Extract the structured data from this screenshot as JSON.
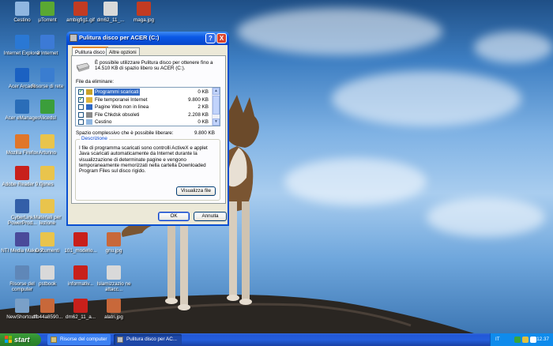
{
  "desktop": {
    "icons": [
      {
        "label": "Cestino",
        "icon": "recycle-bin-icon",
        "color": "#8fb6e0"
      },
      {
        "label": "µTorrent",
        "icon": "utorrent-icon",
        "color": "#5aa832"
      },
      {
        "label": "ambigfig1.gif",
        "icon": "image-file-icon",
        "color": "#c23b22"
      },
      {
        "label": "dm62_11_...",
        "icon": "document-icon",
        "color": "#d9d9d9"
      },
      {
        "label": "maga.jpg",
        "icon": "image-file-icon",
        "color": "#c23b22"
      },
      {
        "label": "Internet Explorer",
        "icon": "internet-explorer-icon",
        "color": "#2a78d4"
      },
      {
        "label": "3 Internet",
        "icon": "network-icon",
        "color": "#3c7ad6"
      },
      {
        "label": "Acer Arcade",
        "icon": "acer-arcade-icon",
        "color": "#1b61c2"
      },
      {
        "label": "Risorse di rete",
        "icon": "network-places-icon",
        "color": "#3a7dd0"
      },
      {
        "label": "Acer eManager",
        "icon": "acer-emanager-icon",
        "color": "#2a6db8"
      },
      {
        "label": "Alicedsl",
        "icon": "alice-icon",
        "color": "#3b9e3b"
      },
      {
        "label": "Mozilla Firefox",
        "icon": "firefox-icon",
        "color": "#e0762a"
      },
      {
        "label": "Arturino",
        "icon": "folder-icon",
        "color": "#e9c44c"
      },
      {
        "label": "Adobe Reader 9.0",
        "icon": "adobe-reader-icon",
        "color": "#c8201b"
      },
      {
        "label": "jones",
        "icon": "folder-icon",
        "color": "#e9c44c"
      },
      {
        "label": "CyberLink PowerProd...",
        "icon": "cyberlink-icon",
        "color": "#335fa8"
      },
      {
        "label": "Materiali per lezione",
        "icon": "folder-icon",
        "color": "#e9c44c"
      },
      {
        "label": "NTI Media Maker 7",
        "icon": "nti-icon",
        "color": "#4a4a9a"
      },
      {
        "label": "Documenti",
        "icon": "my-documents-icon",
        "color": "#e9c44c"
      },
      {
        "label": "101_modello...",
        "icon": "pdf-file-icon",
        "color": "#c8201b"
      },
      {
        "label": "gnu.jpg",
        "icon": "image-file-icon",
        "color": "#c8683a"
      },
      {
        "label": "Risorse del computer",
        "icon": "my-computer-icon",
        "color": "#5f87b8"
      },
      {
        "label": "pstbook",
        "icon": "document-icon",
        "color": "#d9d9d9"
      },
      {
        "label": "informativ...",
        "icon": "pdf-file-icon",
        "color": "#c8201b"
      },
      {
        "label": "Islamizzazio ne attacc...",
        "icon": "document-icon",
        "color": "#d9d9d9"
      },
      {
        "label": "NewShortcut8",
        "icon": "shortcut-icon",
        "color": "#7aa0c8"
      },
      {
        "label": "dfb44a8590...",
        "icon": "image-file-icon",
        "color": "#c8683a"
      },
      {
        "label": "dm62_11_a...",
        "icon": "pdf-file-icon",
        "color": "#c8201b"
      },
      {
        "label": "alatri.jpg",
        "icon": "image-file-icon",
        "color": "#c8683a"
      }
    ]
  },
  "window": {
    "title": "Pulitura disco per ACER (C:)",
    "help_label": "?",
    "close_label": "X",
    "tabs": [
      {
        "label": "Pulitura disco"
      },
      {
        "label": "Altre opzioni"
      }
    ],
    "intro_text": "È possibile utilizzare Pulitura disco per ottenere fino a 14.510 KB di spazio libero su ACER (C:).",
    "files_label": "File da eliminare:",
    "files": [
      {
        "name": "Programmi scaricati",
        "size": "0 KB",
        "checked": "✓",
        "icon_color": "#c9a227"
      },
      {
        "name": "File temporanei Internet",
        "size": "9.800 KB",
        "checked": "✓",
        "icon_color": "#e0b53a"
      },
      {
        "name": "Pagine Web non in linea",
        "size": "2 KB",
        "checked": "",
        "icon_color": "#2f68c4"
      },
      {
        "name": "File Chkdsk obsoleti",
        "size": "2.208 KB",
        "checked": "",
        "icon_color": "#8a8a8a"
      },
      {
        "name": "Cestino",
        "size": "0 KB",
        "checked": "",
        "icon_color": "#8fb6e0"
      }
    ],
    "total_label": "Spazio complessivo che è possibile liberare:",
    "total_value": "9.800 KB",
    "description_legend": "Descrizione",
    "description_text": "I file di programma scaricati sono controlli ActiveX e applet Java scaricati automaticamente da Internet durante la visualizzazione di determinate pagine e vengono temporaneamente memorizzati nella cartella Downloaded Program Files sul disco rigido.",
    "view_files_label": "Visualizza file",
    "ok_label": "OK",
    "cancel_label": "Annulla"
  },
  "taskbar": {
    "start_label": "start",
    "tasks": [
      {
        "label": "Risorse del computer"
      },
      {
        "label": "Pulitura disco per AC..."
      }
    ],
    "language": "IT",
    "clock": "12.37"
  },
  "colors": {
    "titlebar": "#0a58e6",
    "selection": "#316ac5",
    "start": "#2f8f2f",
    "taskbar": "#245edb"
  }
}
